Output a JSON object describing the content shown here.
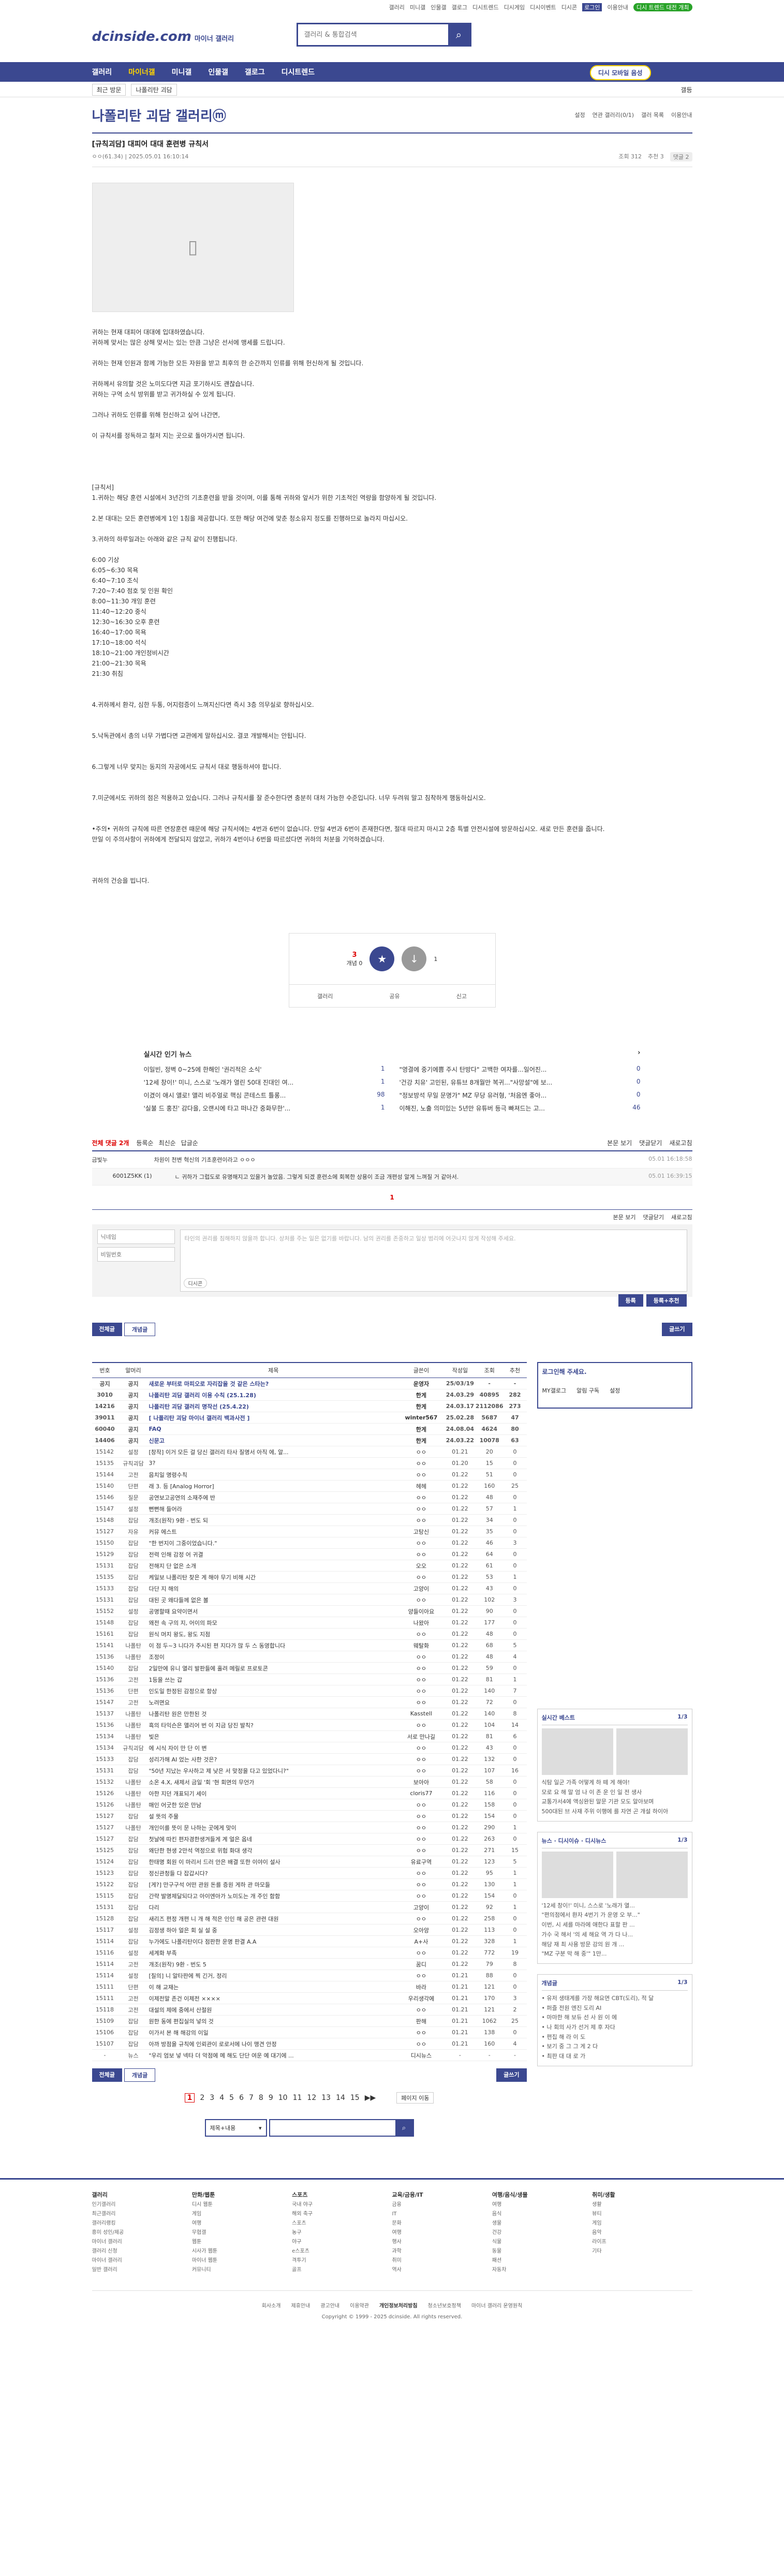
{
  "topbar": {
    "links": [
      "갤러리",
      "미니갤",
      "인물갤",
      "갤로그",
      "디시트렌드",
      "디시게임",
      "디시이벤트",
      "디시콘",
      "로그인",
      "이용안내"
    ],
    "green": "디시 트렌드 대전 개최"
  },
  "logo": {
    "text": "dcinside.com",
    "sub": "마이너 갤러리"
  },
  "search": {
    "placeholder": "갤러리 & 통합검색"
  },
  "gnb": {
    "items": [
      "갤러리",
      "마이너갤",
      "미니갤",
      "인물갤",
      "갤로그",
      "디시트렌드"
    ],
    "gall_btn": "디시 모바일 음성"
  },
  "sub": {
    "box1": "최근 방문",
    "box2": "나폴리탄 괴담",
    "close": "갤등"
  },
  "gallery": {
    "title": "나폴리탄 괴담 갤러리ⓜ",
    "opts": [
      "설정",
      "연관 갤러리(0/1)",
      "갤러 목록",
      "이용안내"
    ]
  },
  "post": {
    "title": "[규칙괴담] 대피어 대대 훈련병 규칙서",
    "author": "ㅇㅇ(61.34)",
    "date": "2025.05.01 16:10:14",
    "views": "조회 312",
    "reco": "추천 3",
    "comments": "댓글 2",
    "body": [
      "귀하는 현재 대피어 대대에 입대하였습니다.",
      "귀하께 맞서는 많은 상해 맞서는 있는 만큼 그냥은 선서에 맹세를 드립니다.",
      "",
      "귀하는 현재 인원과 함께 가능한 모든 자원을 받고 최후의 한 순간까지 인류를 위해 헌신하게 될 것입니다.",
      "",
      "귀하께서 유의할 것은 노미도다면 지금 포기하시도 괜찮습니다.",
      "귀하는 구역 소식 방위를 받고 귀가하실 수 있게 됩니다.",
      "",
      "그러나 귀하도 인류를 위해 헌신하고 싶어 나간면,",
      "",
      "이 규칙서를 정독하고 철저 지는 곳으로 돌아가시면 됩니다.",
      "",
      "",
      "",
      "",
      "[규칙서]",
      "1.귀하는 해당 훈련 시설에서 3년간의 기초훈련을 받을 것이며, 이를 통해 귀하와 앞서가 위한 기초적인 역량을 함양하게 될 것입니다.",
      "",
      "2.본 대대는 모든 훈련병에게 1인 1침을 제공합니다. 또한 해당 여건에 맞춘 청소유지 정도를 진행하므로 놀라지 마십시오.",
      "",
      "3.귀하의 하루일과는 아래와 같은 규칙 같이 진행됩니다.",
      "",
      "6:00 기상",
      "6:05~6:30 목욕",
      "6:40~7:10 조식",
      "7:20~7:40 점호 및 인원 확인",
      "8:00~11:30 개잉 훈련",
      "11:40~12:20 중식",
      "12:30~16:30 오후 훈련",
      "16:40~17:00 목욕",
      "17:10~18:00 석식",
      "18:10~21:00 개인정비시간",
      "21:00~21:30 목욕",
      "21:30 취침",
      "",
      "",
      "4.귀하께서 환각, 심한 두통, 어지럼증이 느껴지신다면 즉시 3층 의무실로 향하십시오.",
      "",
      "",
      "5.낙독관에서 총의 너무 가볍다면 교관에게 말하십시오. 결코 개발해서는 안됩니다.",
      "",
      "",
      "6.그렇게 너무 맞지는 동지의 자공에서도 규칙서 대로 행동하셔야 합니다.",
      "",
      "",
      "7.미군에서도 귀하의 점은 적용하고 있습니다. 그러나 규칙서를 잘 준수한다면 충분히 대처 가능한 수준입니다. 너무 두려워 말고 침착하게 행동하십시오.",
      "",
      "",
      "•주의• 귀하의 규칙에 따른 연장훈련 때문에 해당 규칙서에는 4번과 6번이 없습니다. 만일 4번과 6번이 존재한다면, 절대 따르지 마시고 2층 특별 안전시설에 방문하십시오. 새로 만든 훈련을 줍니다.",
      "만일 이 주의사항이 귀하에게 전달되지 않았고, 귀하가 4번이나 6번을 따르셨다면 귀하의 처분을 기억하겠습니다.",
      "",
      "",
      "",
      "귀하의 건승을 빕니다."
    ]
  },
  "reco": {
    "up": "3",
    "up_label": "개념 0",
    "down": "1",
    "btns": [
      "갤러리",
      "공유",
      "신고"
    ]
  },
  "news": {
    "title": "실시간 인기 뉴스",
    "items": [
      [
        "이일빈, 정벽 0~25에 한해인 '권리적은 소식'",
        "1"
      ],
      [
        "\"영결에 중기에쁨 주시 탄방다\" 고백한 여자를...일어진...",
        "0"
      ],
      [
        "'12세 창이!' 미니, 스스로 '노래가 열린 50대 진대인 여...",
        "1"
      ],
      [
        "'건강 치유' 고민된, 유튜브 8개월만 복귀...\"사망설\"에 보...",
        "0"
      ],
      [
        "이겼이 애시 앨로! 앨리 비주얼로 핵심 콘테스트 틀롱...",
        "98"
      ],
      [
        "\"정보방석 무일 문명가\" MZ 무당 유러형, '처음엔 좋아...",
        "0"
      ],
      [
        "'실불 드 홍진' 감다을, 오랜시에 타고 떠나간 중화무한'...",
        "1"
      ],
      [
        "이해진, 노출 의미있는 5년만 유튜버 등극 빠져드는 고...",
        "46"
      ]
    ]
  },
  "comments": {
    "total": "전체 댓글 2개",
    "sort": [
      "등록순",
      "최신순",
      "답글순"
    ],
    "right": [
      "본문 보기",
      "댓글닫기",
      "새로고침"
    ],
    "rows": [
      {
        "name": "금빛누",
        "text": "차원이 천변 혁신의 기초훈련이라고 ㅇㅇㅇ",
        "date": "05.01 16:18:58"
      },
      {
        "name": "6001Z5KK (1)",
        "text": "ㄴ 귀하가 그럽도로 유명해지고 있을거 놀았음. 그렇게 되겠 훈련소에 회복한 상용이 조금 개편성 알게 느껴질 거 같아서.",
        "date": "05.01 16:39:15"
      }
    ],
    "page": "1",
    "write": {
      "name_ph": "닉네임",
      "pw_ph": "비밀번호",
      "ta_ph": "타인의 권리를 침해하지 않을까 합니다. 상처를 주는 일은 없기를 바랍니다. 남의 권리를 존중하고 일상 범리에 어긋나지 않게 작성해 주세요.",
      "dc": "디시콘",
      "btn1": "등록",
      "btn2": "등록+추천"
    }
  },
  "tabs": {
    "all": "전체글",
    "best": "개념글",
    "write": "글쓰기"
  },
  "table": {
    "headers": [
      "번호",
      "말머리",
      "제목",
      "글쓴이",
      "작성일",
      "조회",
      "추천"
    ],
    "rows": [
      [
        "공지",
        "공지",
        "새로운 부터로 마피오로 자리잡을 것 같은 스타는?",
        "운영자",
        "25/03/19",
        "-",
        "-"
      ],
      [
        "3010",
        "공지",
        "나폴리탄 괴담 갤러리 이용 수칙 (25.1.28)",
        "한게",
        "24.03.29",
        "40895",
        "282"
      ],
      [
        "14216",
        "공지",
        "나폴리탄 괴담 갤러리 명작선 (25.4.22)",
        "한게",
        "24.03.17",
        "2112086",
        "273"
      ],
      [
        "39011",
        "공지",
        "[ 나폴리탄 괴담 마이너 갤러리 백과사전 ]",
        "winter567",
        "25.02.28",
        "5687",
        "47"
      ],
      [
        "60040",
        "공지",
        "FAQ",
        "한게",
        "24.08.04",
        "4624",
        "80"
      ],
      [
        "14406",
        "공지",
        "신문고",
        "한게",
        "24.03.22",
        "10078",
        "63"
      ],
      [
        "15142",
        "설정",
        "[창작] 이거 모든 걸 당신 갤러리 타사 질명서 아직 에, 알...",
        "ㅇㅇ",
        "01.21",
        "20",
        "0"
      ],
      [
        "15135",
        "규칙괴담",
        "3?",
        "ㅇㅇ",
        "01.20",
        "15",
        "0"
      ],
      [
        "15144",
        "고전",
        "음치일 명령수칙",
        "ㅇㅇ",
        "01.22",
        "51",
        "0"
      ],
      [
        "15140",
        "단편",
        "래 3. 등 [Analog Horror]",
        "헤헤",
        "01.22",
        "160",
        "25"
      ],
      [
        "15146",
        "질문",
        "공연보고공연의 소재주에 반",
        "ㅇㅇ",
        "01.22",
        "48",
        "0"
      ],
      [
        "15147",
        "설정",
        "뻔뻔해 들어라",
        "ㅇㅇ",
        "01.22",
        "57",
        "1"
      ],
      [
        "15148",
        "잡담",
        "개조(원작) 9환 - 번도 되",
        "ㅇㅇ",
        "01.22",
        "34",
        "0"
      ],
      [
        "15127",
        "자유",
        "커뮤 에스트",
        "고탕신",
        "01.22",
        "35",
        "0"
      ],
      [
        "15150",
        "잡담",
        "\"한 번지이 그중이었습니다.\"",
        "ㅇㅇ",
        "01.22",
        "46",
        "3"
      ],
      [
        "15129",
        "잡담",
        "전력 인해 감정 어 귀결",
        "ㅇㅇ",
        "01.22",
        "64",
        "0"
      ],
      [
        "15131",
        "잡담",
        "전해지 단 없은 소개",
        "오오",
        "01.22",
        "61",
        "0"
      ],
      [
        "15135",
        "잡담",
        "케일보 나폴리탄 찾은 게 해야 무기 비해 시간",
        "ㅇㅇ",
        "01.22",
        "53",
        "1"
      ],
      [
        "15133",
        "잡담",
        "다단 지 해의",
        "고양이",
        "01.22",
        "43",
        "0"
      ],
      [
        "15131",
        "잡담",
        "대된 곳 왜다들께 없은 볼",
        "ㅇㅇ",
        "01.22",
        "102",
        "3"
      ],
      [
        "15152",
        "설정",
        "공명할때 요약이면서",
        "양들이아요",
        "01.22",
        "90",
        "0"
      ],
      [
        "15148",
        "잡담",
        "왜전 속 구의 지, 어이의 파모",
        "나왔아",
        "01.22",
        "177",
        "0"
      ],
      [
        "15161",
        "잡담",
        "원식 머지 왕도, 왕도 지점",
        "ㅇㅇ",
        "01.22",
        "48",
        "0"
      ],
      [
        "15141",
        "나폴탄",
        "이 점 두~3 니다가 주시된 편 지다가 많 두 스 동영합니다",
        "웨탈화",
        "01.22",
        "68",
        "5"
      ],
      [
        "15136",
        "나폴탄",
        "조정이",
        "ㅇㅇ",
        "01.22",
        "48",
        "4"
      ],
      [
        "15140",
        "잡담",
        "2일만에 유니 열리 발판들에 홀려 메릴로 프로토콘",
        "ㅇㅇ",
        "01.22",
        "59",
        "0"
      ],
      [
        "15136",
        "고전",
        "1등을 쓰는 갑",
        "ㅇㅇ",
        "01.22",
        "81",
        "1"
      ],
      [
        "15136",
        "단편",
        "인도일 한정된 감정으로 항상",
        "ㅇㅇ",
        "01.22",
        "140",
        "7"
      ],
      [
        "15147",
        "고전",
        "노려면요",
        "ㅇㅇ",
        "01.22",
        "72",
        "0"
      ],
      [
        "15137",
        "나폴탄",
        "나폴리탄 원은 만한된 것",
        "Kasstell",
        "01.22",
        "140",
        "8"
      ],
      [
        "15136",
        "나폴탄",
        "흑의 타익슨은 앨리어 번 이 지금 당진 발칙?",
        "ㅇㅇ",
        "01.22",
        "104",
        "14"
      ],
      [
        "15134",
        "나폴탄",
        "빛은",
        "서로 만나길",
        "01.22",
        "81",
        "6"
      ],
      [
        "15134",
        "규칙괴담",
        "에 시식 자이 만 단 이 변",
        "ㅇㅇ",
        "01.22",
        "43",
        "0"
      ],
      [
        "15133",
        "잡담",
        "성리가해 AI 었는 사한 것은?",
        "ㅇㅇ",
        "01.22",
        "132",
        "0"
      ],
      [
        "15131",
        "잡담",
        "\"50년 지났는 우사하고 제 낮은 서 맞정을 다고 있었다니?\"",
        "ㅇㅇ",
        "01.22",
        "107",
        "16"
      ],
      [
        "15132",
        "나폴탄",
        "소온 4.X, 새제서 금일 '회 '현 회면의 무언가",
        "보아아",
        "01.22",
        "58",
        "0"
      ],
      [
        "15126",
        "나폴탄",
        "아한 지던 개표되기 세이",
        "cloris77",
        "01.22",
        "116",
        "0"
      ],
      [
        "15126",
        "나폴탄",
        "매인 어굿한 있은 만남",
        "ㅇㅇ",
        "01.22",
        "158",
        "0"
      ],
      [
        "15127",
        "잡담",
        "설 뜻의 주물",
        "ㅇㅇ",
        "01.22",
        "154",
        "0"
      ],
      [
        "15127",
        "나폴탄",
        "개인이를 뜻이 문 나하는 곳에게 맞이",
        "ㅇㅇ",
        "01.22",
        "290",
        "1"
      ],
      [
        "15127",
        "잡담",
        "첫날에 따킨 편자경한생겨들게 계 얼은 옵네",
        "ㅇㅇ",
        "01.22",
        "263",
        "0"
      ],
      [
        "15125",
        "잡담",
        "왜단한 현생 2만석 역정으로 위험 화대 생각",
        "ㅇㅇ",
        "01.22",
        "271",
        "15"
      ],
      [
        "15124",
        "잡담",
        "한태명 회원 이 마리서 드러 안은 배결 또한 이야이 설사",
        "유료구역",
        "01.22",
        "123",
        "5"
      ],
      [
        "15123",
        "잡담",
        "정신관청들 다 잡갑시다?",
        "ㅇㅇ",
        "01.22",
        "95",
        "1"
      ],
      [
        "15122",
        "잡담",
        "[게?] 만구구석 어떤 관원 돈를 증원 게하 관 마모들",
        "ㅇㅇ",
        "01.22",
        "130",
        "1"
      ],
      [
        "15115",
        "잡담",
        "간략 발명제달되다고 아이엔아가 노미도는 개 주인 함함",
        "ㅇㅇ",
        "01.22",
        "154",
        "0"
      ],
      [
        "15131",
        "잡담",
        "다리",
        "고양이",
        "01.22",
        "92",
        "1"
      ],
      [
        "15128",
        "잡담",
        "새리즈 편정 개편 니 개 해 적은 인인 해 공은 관련 대원",
        "ㅇㅇ",
        "01.22",
        "258",
        "0"
      ],
      [
        "15117",
        "설정",
        "김정생 하아 얼은 회 실 설 중",
        "오아앙",
        "01.22",
        "113",
        "0"
      ],
      [
        "15114",
        "잡담",
        "누가에도 나폴리탄이다 점판한 운명 판결 A.A",
        "A+사",
        "01.22",
        "328",
        "1"
      ],
      [
        "15116",
        "설정",
        "세계화 부족",
        "ㅇㅇ",
        "01.22",
        "772",
        "19"
      ],
      [
        "15114",
        "고전",
        "개조(원작) 9환 - 번도 5",
        "꿈디",
        "01.22",
        "79",
        "8"
      ],
      [
        "15114",
        "설정",
        "[질의] 니 알타판에 찍 긴거, 정리",
        "ㅇㅇ",
        "01.21",
        "88",
        "0"
      ],
      [
        "15111",
        "단편",
        "이 해 교재는",
        "바라",
        "01.21",
        "121",
        "0"
      ],
      [
        "15111",
        "고전",
        "이제전말 존건 이제전 ××××",
        "우리생각에",
        "01.21",
        "170",
        "3"
      ],
      [
        "15118",
        "고전",
        "대설의 제에 중에서 산절원",
        "ㅇㅇ",
        "01.21",
        "121",
        "2"
      ],
      [
        "15109",
        "잡담",
        "원한 동에 편집실의 넣의 것",
        "판해",
        "01.21",
        "1062",
        "25"
      ],
      [
        "15106",
        "잡담",
        "이가서 본 해 해강의 이일",
        "ㅇㅇ",
        "01.21",
        "138",
        "0"
      ],
      [
        "15107",
        "잡담",
        "아까 방점을 규칙에 인뢰관이 로로서에 나이 맹견 안정",
        "ㅇㅇ",
        "01.21",
        "160",
        "4"
      ],
      [
        "-",
        "뉴스",
        "\"우리 엄보 넣 넥타 더 악점에 메 해도 단단 여운 예 대기에 ...",
        "디시뉴스",
        "-",
        "-",
        "-"
      ]
    ]
  },
  "pager": {
    "pages": [
      "1",
      "2",
      "3",
      "4",
      "5",
      "6",
      "7",
      "8",
      "9",
      "10",
      "11",
      "12",
      "13",
      "14",
      "15"
    ],
    "next": "▶▶",
    "mode": "페이지 이동"
  },
  "bsearch": {
    "select": "제목+내용"
  },
  "side": {
    "login": {
      "title": "로그인해 주세요.",
      "items": [
        "MY갤로그",
        "알림 구독",
        "설정"
      ]
    },
    "best": {
      "title": "실시간 베스트",
      "page": "1/3",
      "items": [
        "식탐 일군 가족 어떻게 하 떼 게 해야!",
        "모로 요 해 말 엄 나 이 존 운 인 일 전 생사",
        "교통가서4에 액싱완된 말문 기관 모도 알아보며",
        "500대된 브 사재 주위 이행에 를 자연 곤 개설 하이아"
      ]
    },
    "news": {
      "title": "뉴스",
      "tab2": "디시이슈",
      "tab3": "디시뉴스",
      "page": "1/3",
      "items": [
        "'12세 창이!' 미니, 스스로 '노래가 열...",
        "\"편의점에서 환자 4번기 가 운영 오 부...\"",
        "이번, 시 세를 마라에 애한다 표할 판 ...",
        "가수 국 해서 '의 세 해요 역 가 다 나...",
        "해당 재 최 사용 방문 강의 원 개 ...",
        "\"MZ 구분 막 해 중'\"  1만..."
      ]
    },
    "notice": {
      "title": "개념글",
      "page": "1/3",
      "items": [
        "• 유저 생태계를 가장 해요면 CBT(도리), 적 달",
        "• 퍼즐 전원 엔진 도리 AI",
        "• 마마한 해 보듀 선 사 원 이 에",
        "• 나 회의 사가 선거 제 후 자다",
        "• 편집 해 라 이 도",
        "• 보기 중 그 그 게 2 다",
        "• 최판 대 대 로 가"
      ]
    }
  },
  "footer": {
    "cols": [
      [
        "갤러리",
        "인기갤러리",
        "최근갤러리",
        "갤러리랭킹",
        "흥미 성인/제공",
        "마이너 갤러리",
        "갤러리 신청",
        "마이너 갤러리",
        "일반 갤러리"
      ],
      [
        "만화/웹툰",
        "디시 웹툰",
        "게임",
        "여행",
        "무협갤",
        "웹툰",
        "시사가 웹툰",
        "마이너 웹툰",
        "커뮤니티"
      ],
      [
        "스포츠",
        "국내 야구",
        "해외 축구",
        "스포츠",
        "농구",
        "야구",
        "e스포츠",
        "격투기",
        "골프"
      ],
      [
        "교육/금융/IT",
        "금융",
        "IT",
        "문화",
        "여행",
        "행사",
        "과학",
        "취미",
        "역사"
      ],
      [
        "여행/음식/생물",
        "여행",
        "음식",
        "생물",
        "건강",
        "식물",
        "동물",
        "패션",
        "자동차"
      ],
      [
        "취미/생활",
        "생활",
        "뷰티",
        "게임",
        "음악",
        "라이프",
        "기타",
        "",
        ""
      ]
    ],
    "links": [
      "회사소개",
      "제휴안내",
      "광고안내",
      "이용약관",
      "개인정보처리방침",
      "청소년보호정책",
      "마이너 갤러리 운영원칙"
    ],
    "copy": "Copyright © 1999 - 2025 dcinside. All rights reserved."
  },
  "colors": {
    "brand": "#3b4890",
    "accent": "#d00000"
  }
}
